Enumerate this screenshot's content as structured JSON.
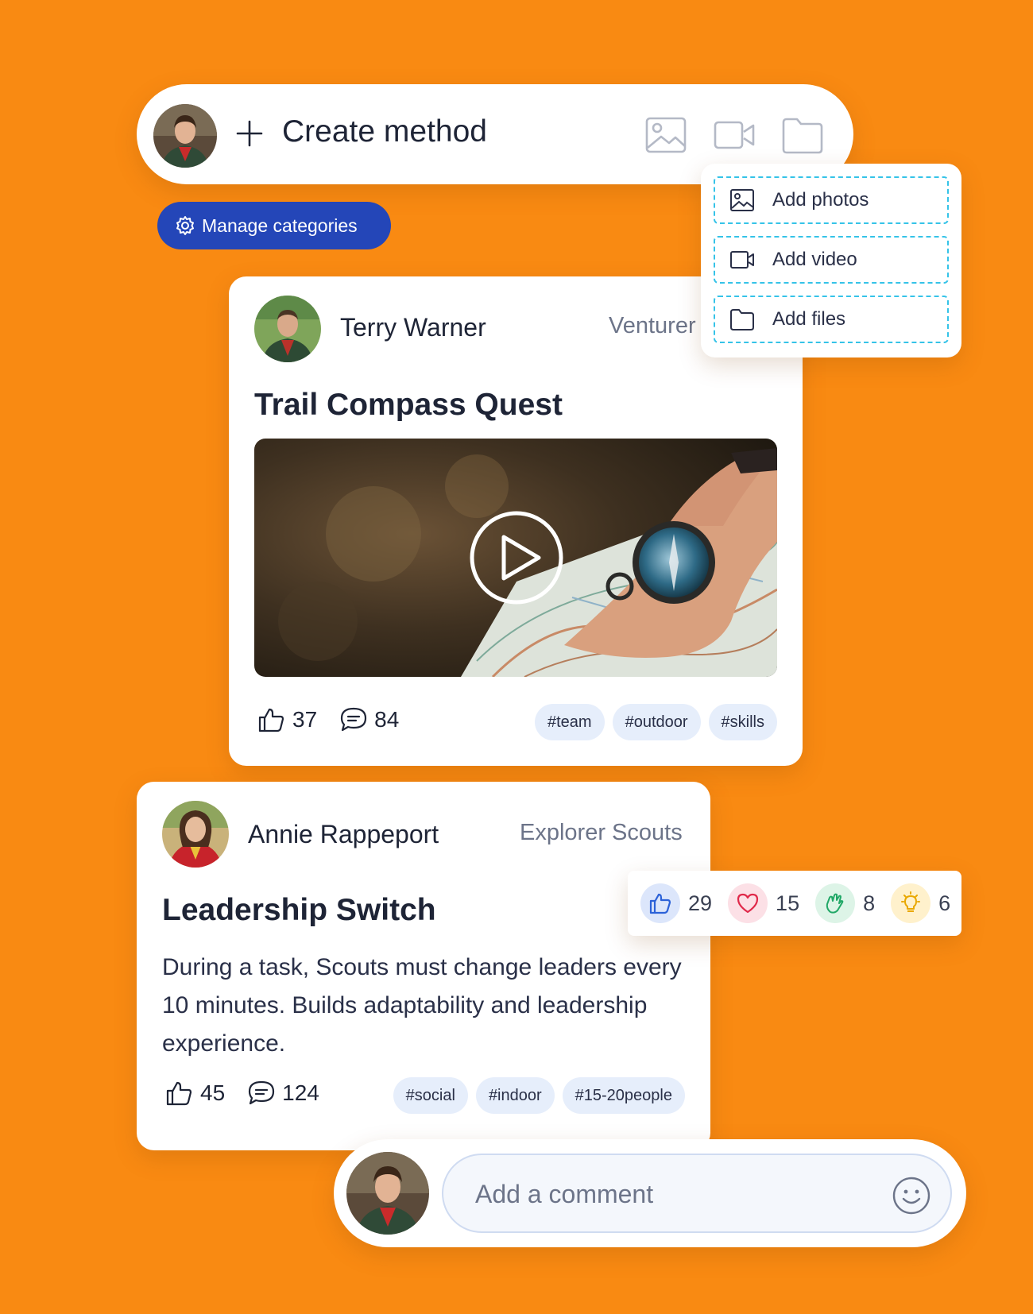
{
  "colors": {
    "background": "#F98A12",
    "primary": "#2446B8",
    "tag_bg": "#E6EEFB",
    "dashed_accent": "#35C3E8",
    "like_bubble": "#DCE6FB",
    "love_bubble": "#FCE0E6",
    "clap_bubble": "#DDF4E7",
    "idea_bubble": "#FFF1CC"
  },
  "composer": {
    "avatar": "scout-girl-avatar",
    "plus_icon": "plus-icon",
    "label": "Create method",
    "icons": [
      "image-icon",
      "video-camera-icon",
      "folder-icon"
    ]
  },
  "manage_categories": {
    "icon": "gear-icon",
    "label": "Manage categories"
  },
  "attach_menu": {
    "items": [
      {
        "icon": "image-icon",
        "label": "Add photos"
      },
      {
        "icon": "video-camera-icon",
        "label": "Add video"
      },
      {
        "icon": "folder-icon",
        "label": "Add files"
      }
    ]
  },
  "posts": [
    {
      "author": "Terry Warner",
      "group": "Venturer",
      "title": "Trail Compass Quest",
      "media": "video",
      "likes": "37",
      "comments": "84",
      "tags": [
        "#team",
        "#outdoor",
        "#skills"
      ]
    },
    {
      "author": "Annie Rappeport",
      "group": "Explorer Scouts",
      "title": "Leadership Switch",
      "body": "During a task, Scouts must change leaders every 10 minutes. Builds adaptability and leadership experience.",
      "likes": "45",
      "comments": "124",
      "tags": [
        "#social",
        "#indoor",
        "#15-20people"
      ]
    }
  ],
  "reactions": [
    {
      "icon": "thumbs-up-icon",
      "count": "29"
    },
    {
      "icon": "heart-icon",
      "count": "15"
    },
    {
      "icon": "clap-icon",
      "count": "8"
    },
    {
      "icon": "lightbulb-icon",
      "count": "6"
    }
  ],
  "comment_box": {
    "placeholder": "Add a comment",
    "emoji_icon": "smiley-icon"
  }
}
